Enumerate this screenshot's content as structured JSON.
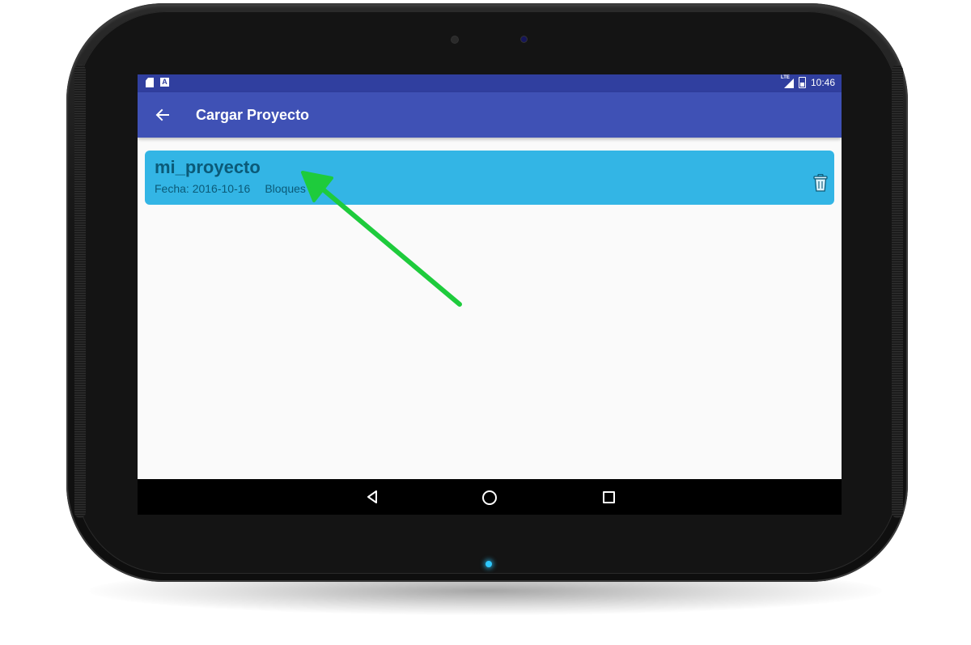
{
  "status_bar": {
    "time": "10:46",
    "network_label": "LTE",
    "left_icons": [
      "sd-card-icon",
      "a-notification-icon"
    ],
    "right_icons": [
      "signal-icon",
      "battery-icon"
    ]
  },
  "app_bar": {
    "title": "Cargar Proyecto",
    "back_icon": "arrow-left-icon"
  },
  "projects": [
    {
      "name": "mi_proyecto",
      "fecha": "Fecha: 2016-10-16",
      "bloques": "Bloques",
      "action_icon": "trash-icon"
    }
  ],
  "nav_bar": {
    "icons": [
      "nav-back-icon",
      "nav-home-icon",
      "nav-recents-icon"
    ]
  },
  "a_icon_label": "A",
  "colors": {
    "status_bar": "#303f9f",
    "app_bar": "#3f51b5",
    "card": "#33b5e5",
    "card_text": "#0b5a78",
    "annotation_arrow": "#1ecb3c",
    "led": "#2ec8ff"
  }
}
